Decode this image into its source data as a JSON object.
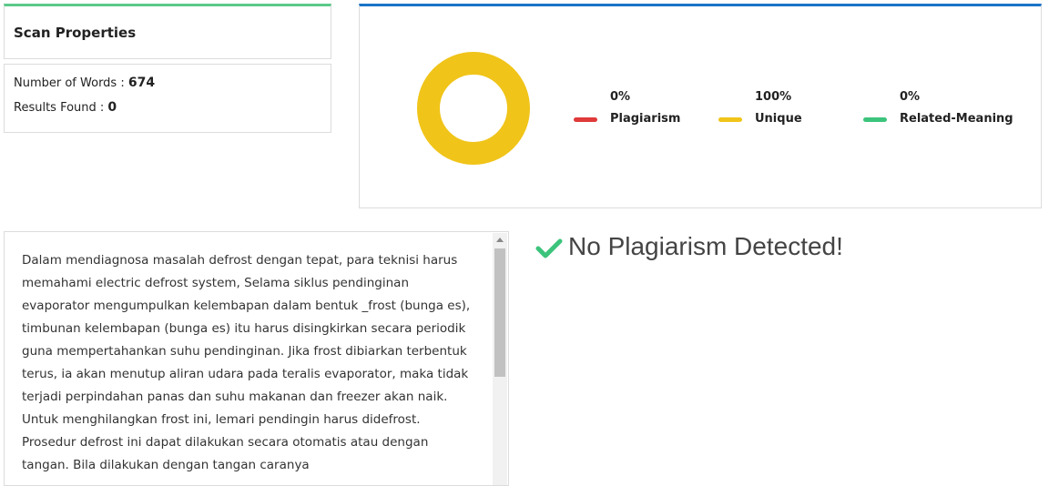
{
  "scan_properties": {
    "title": "Scan Properties",
    "words_label": "Number of Words : ",
    "words_value": "674",
    "results_label": "Results Found : ",
    "results_value": "0"
  },
  "summary": {
    "colors": {
      "plagiarism": "#e03a3a",
      "unique": "#f0c419",
      "related": "#3cc47c"
    },
    "donut_fraction_unique": 1.0,
    "legend": [
      {
        "pct": "0%",
        "label": "Plagiarism"
      },
      {
        "pct": "100%",
        "label": "Unique"
      },
      {
        "pct": "0%",
        "label": "Related-Meaning"
      }
    ]
  },
  "text_content": "Dalam mendiagnosa masalah defrost dengan tepat, para teknisi harus memahami electric defrost system, Selama siklus pendinginan evaporator mengumpulkan kelembapan dalam bentuk _frost (bunga es), timbunan kelembapan (bunga es) itu harus disingkirkan secara periodik guna mempertahankan suhu pendinginan. Jika frost dibiarkan terbentuk terus, ia akan menutup aliran udara pada teralis evaporator, maka tidak terjadi perpindahan panas dan suhu makanan dan freezer akan naik. Untuk menghilangkan frost ini, lemari pendingin harus didefrost. Prosedur defrost ini dapat dilakukan secara otomatis atau dengan tangan. Bila dilakukan dengan tangan caranya",
  "result": {
    "message": "No Plagiarism Detected!",
    "icon": "check-icon",
    "icon_color": "#3cc47c"
  }
}
